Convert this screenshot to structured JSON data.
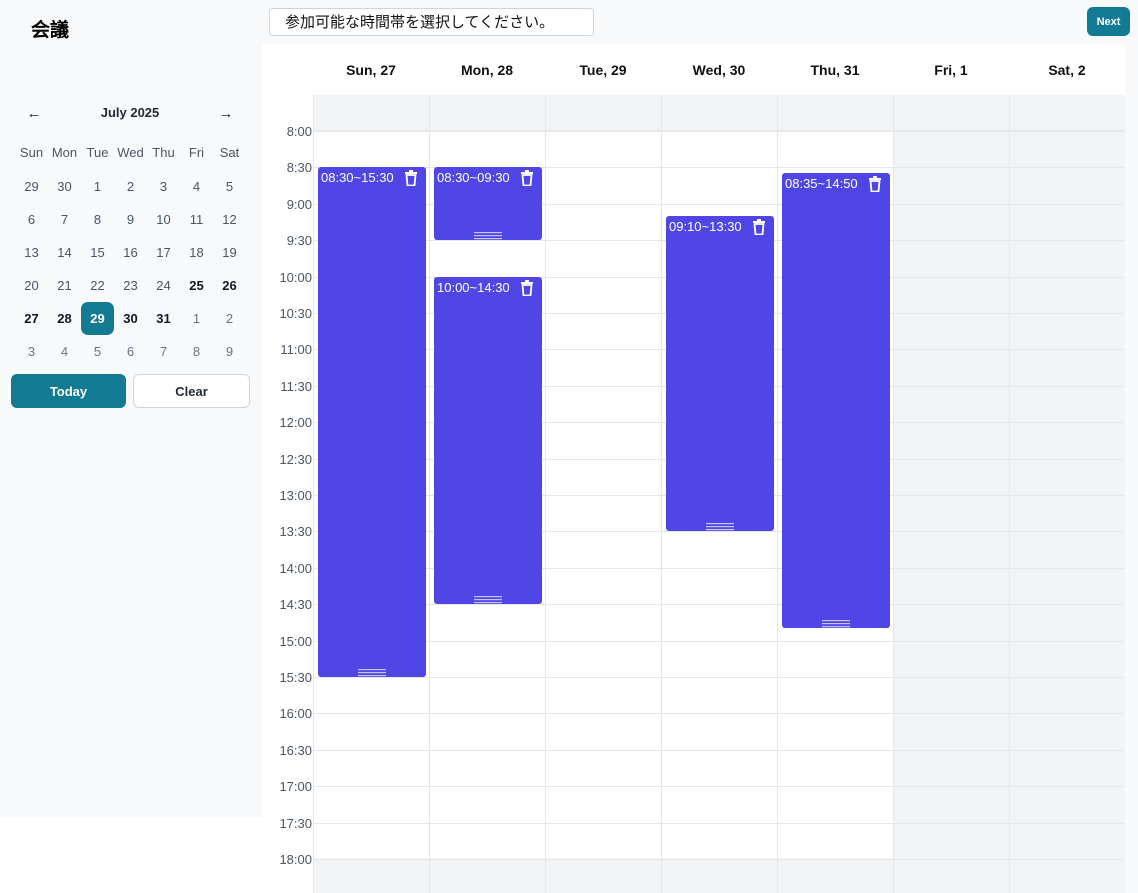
{
  "app": {
    "title": "会議"
  },
  "instruction": "参加可能な時間帯を選択してください。",
  "next_label": "Next",
  "mini_calendar": {
    "month_label": "July 2025",
    "prev_icon": "arrow-left-icon",
    "next_icon": "arrow-right-icon",
    "weekdays": [
      "Sun",
      "Mon",
      "Tue",
      "Wed",
      "Thu",
      "Fri",
      "Sat"
    ],
    "weeks": [
      [
        {
          "d": "29",
          "s": "normal"
        },
        {
          "d": "30",
          "s": "normal"
        },
        {
          "d": "1",
          "s": "normal"
        },
        {
          "d": "2",
          "s": "normal"
        },
        {
          "d": "3",
          "s": "normal"
        },
        {
          "d": "4",
          "s": "normal"
        },
        {
          "d": "5",
          "s": "normal"
        }
      ],
      [
        {
          "d": "6",
          "s": "normal"
        },
        {
          "d": "7",
          "s": "normal"
        },
        {
          "d": "8",
          "s": "normal"
        },
        {
          "d": "9",
          "s": "normal"
        },
        {
          "d": "10",
          "s": "normal"
        },
        {
          "d": "11",
          "s": "normal"
        },
        {
          "d": "12",
          "s": "normal"
        }
      ],
      [
        {
          "d": "13",
          "s": "normal"
        },
        {
          "d": "14",
          "s": "normal"
        },
        {
          "d": "15",
          "s": "normal"
        },
        {
          "d": "16",
          "s": "normal"
        },
        {
          "d": "17",
          "s": "normal"
        },
        {
          "d": "18",
          "s": "normal"
        },
        {
          "d": "19",
          "s": "normal"
        }
      ],
      [
        {
          "d": "20",
          "s": "normal"
        },
        {
          "d": "21",
          "s": "normal"
        },
        {
          "d": "22",
          "s": "normal"
        },
        {
          "d": "23",
          "s": "normal"
        },
        {
          "d": "24",
          "s": "normal"
        },
        {
          "d": "25",
          "s": "bold"
        },
        {
          "d": "26",
          "s": "bold"
        }
      ],
      [
        {
          "d": "27",
          "s": "bold"
        },
        {
          "d": "28",
          "s": "bold"
        },
        {
          "d": "29",
          "s": "selected"
        },
        {
          "d": "30",
          "s": "bold"
        },
        {
          "d": "31",
          "s": "bold"
        },
        {
          "d": "1",
          "s": "muted"
        },
        {
          "d": "2",
          "s": "muted"
        }
      ],
      [
        {
          "d": "3",
          "s": "muted"
        },
        {
          "d": "4",
          "s": "muted"
        },
        {
          "d": "5",
          "s": "muted"
        },
        {
          "d": "6",
          "s": "muted"
        },
        {
          "d": "7",
          "s": "muted"
        },
        {
          "d": "8",
          "s": "muted"
        },
        {
          "d": "9",
          "s": "muted"
        }
      ]
    ],
    "today_label": "Today",
    "clear_label": "Clear"
  },
  "week": {
    "days": [
      {
        "label": "Sun, 27",
        "weekend": false
      },
      {
        "label": "Mon, 28",
        "weekend": false
      },
      {
        "label": "Tue, 29",
        "weekend": false
      },
      {
        "label": "Wed, 30",
        "weekend": false
      },
      {
        "label": "Thu, 31",
        "weekend": false
      },
      {
        "label": "Fri, 1",
        "weekend": true
      },
      {
        "label": "Sat, 2",
        "weekend": true
      }
    ],
    "time_labels": [
      "8:00",
      "8:30",
      "9:00",
      "9:30",
      "10:00",
      "10:30",
      "11:00",
      "11:30",
      "12:00",
      "12:30",
      "13:00",
      "13:30",
      "14:00",
      "14:30",
      "15:00",
      "15:30",
      "16:00",
      "16:30",
      "17:00",
      "17:30",
      "18:00"
    ],
    "events": [
      {
        "day": 0,
        "start": "08:30",
        "end": "15:30",
        "label": "08:30~15:30"
      },
      {
        "day": 1,
        "start": "08:30",
        "end": "09:30",
        "label": "08:30~09:30"
      },
      {
        "day": 1,
        "start": "10:00",
        "end": "14:30",
        "label": "10:00~14:30"
      },
      {
        "day": 3,
        "start": "09:10",
        "end": "13:30",
        "label": "09:10~13:30"
      },
      {
        "day": 4,
        "start": "08:35",
        "end": "14:50",
        "label": "08:35~14:50"
      }
    ]
  },
  "colors": {
    "accent": "#137a94",
    "event": "#4f46e5",
    "weekend_bg": "#f2f3f5"
  }
}
